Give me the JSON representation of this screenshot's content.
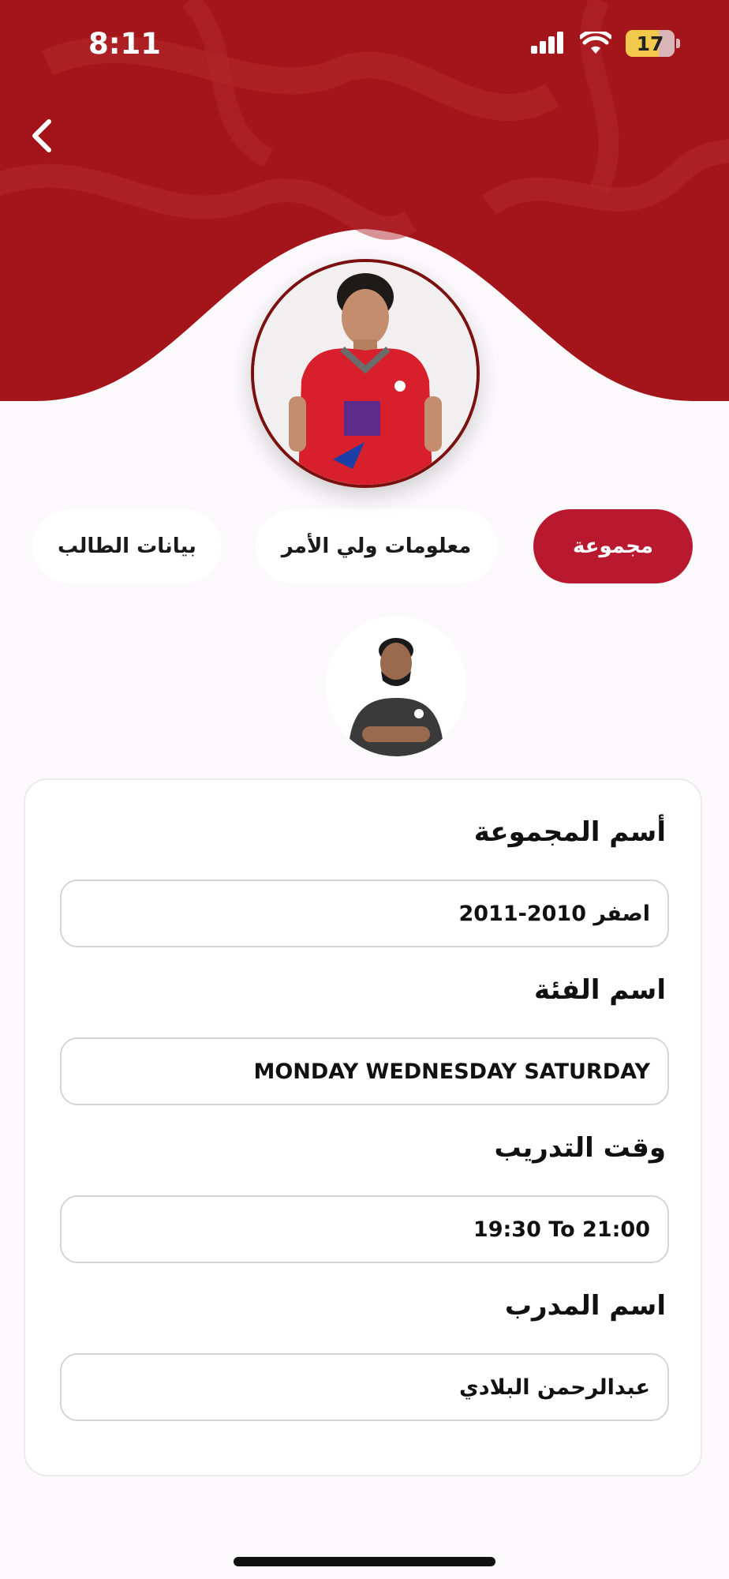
{
  "status_bar": {
    "time": "8:11",
    "battery": "17"
  },
  "header": {
    "back_icon": "chevron-left-icon",
    "accent_color": "#a3151a"
  },
  "tabs": [
    {
      "label": "مجموعة",
      "active": true
    },
    {
      "label": "معلومات ولي الأمر",
      "active": false
    },
    {
      "label": "بيانات الطالب",
      "active": false
    }
  ],
  "card": {
    "fields": [
      {
        "label": "أسم المجموعة",
        "value": "اصفر 2010-2011"
      },
      {
        "label": "اسم الفئة",
        "value": "MONDAY WEDNESDAY SATURDAY"
      },
      {
        "label": "وقت التدريب",
        "value": "19:30 To 21:00"
      },
      {
        "label": "اسم المدرب",
        "value": "عبدالرحمن البلادي"
      }
    ]
  },
  "colors": {
    "primary": "#b8192f",
    "header_bg": "#a3151a",
    "page_bg": "#fbf9fb"
  }
}
